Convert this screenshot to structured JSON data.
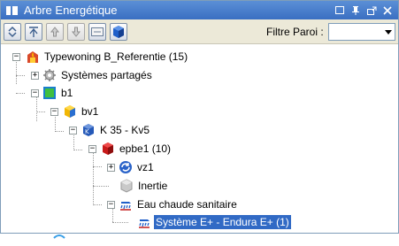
{
  "window": {
    "title": "Arbre Energétique"
  },
  "toolbar": {
    "filter_label": "Filtre Paroi :",
    "filter_value": ""
  },
  "tree": {
    "nodes": [
      {
        "label": "Typewoning B_Referentie (15)",
        "icon": "building-flame-icon"
      },
      {
        "label": "Systèmes partagés",
        "icon": "gear-icon"
      },
      {
        "label": "b1",
        "icon": "green-cube-icon"
      },
      {
        "label": "bv1",
        "icon": "yellow-cube-icon"
      },
      {
        "label": "K 35 - Kv5",
        "icon": "blue-k-cube-icon"
      },
      {
        "label": "epbe1 (10)",
        "icon": "red-cube-icon"
      },
      {
        "label": "vz1",
        "icon": "blue-cycle-icon"
      },
      {
        "label": "Inertie",
        "icon": "gray-cube-icon"
      },
      {
        "label": "Eau chaude sanitaire",
        "icon": "shower-icon"
      },
      {
        "label": "Système E+ - Endura E+ (1)",
        "icon": "shower-icon"
      }
    ]
  },
  "colors": {
    "selection": "#316ac5",
    "titlebar": "#3a6fc2"
  }
}
